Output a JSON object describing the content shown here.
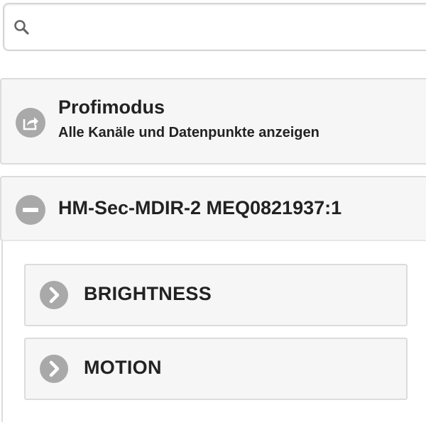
{
  "search": {
    "value": "",
    "placeholder": "",
    "icon": "search-icon"
  },
  "profimodus": {
    "title": "Profimodus",
    "subtitle": "Alle Kanäle und Datenpunkte anzeigen",
    "icon": "share-icon"
  },
  "device": {
    "title": "HM-Sec-MDIR-2 MEQ0821937:1",
    "icon": "minus-circle-icon",
    "channels": [
      {
        "label": "BRIGHTNESS",
        "icon": "chevron-right-icon"
      },
      {
        "label": "MOTION",
        "icon": "chevron-right-icon"
      }
    ]
  },
  "colors": {
    "icon_gray": "#a9a9a9",
    "panel_bg": "#f6f6f6",
    "border": "#dcdcdc",
    "text": "#222222"
  }
}
